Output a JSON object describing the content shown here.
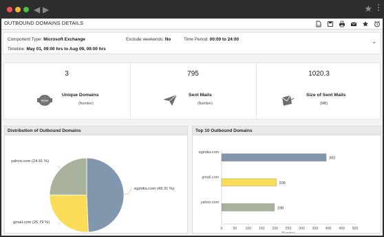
{
  "browser": {
    "back_icon": "chevron-left-icon",
    "forward_icon": "chevron-right-icon",
    "bookmark_icon": "star-icon",
    "menu_icon": "kebab-menu-icon"
  },
  "header": {
    "title": "OUTBOUND DOMAINS DETAILS",
    "icons": [
      "export-pdf-icon",
      "save-icon",
      "print-icon",
      "email-icon",
      "bookmark-star-icon",
      "schedule-clock-icon"
    ]
  },
  "filters": {
    "component_type_label": "Component Type:",
    "component_type_value": "Microsoft Exchange",
    "exclude_weekends_label": "Exclude weekends:",
    "exclude_weekends_value": "No",
    "time_period_label": "Time Period:",
    "time_period_value": "00:00 to 24:00",
    "timeline_label": "Timeline:",
    "timeline_value": "May 01, 09:00 hrs to Aug 09, 09:00 hrs"
  },
  "stats": [
    {
      "value": "3",
      "label": "Unique Domains",
      "unit": "(Number)",
      "icon": "www-globe-icon"
    },
    {
      "value": "795",
      "label": "Sent Mails",
      "unit": "(Number)",
      "icon": "paper-plane-icon"
    },
    {
      "value": "1020.3",
      "label": "Size of Sent Mails",
      "unit": "(MB)",
      "icon": "mail-size-icon"
    }
  ],
  "panels": {
    "pie_title": "Distribution of Outbound Domains",
    "bar_title": "Top 10 Outbound Domains"
  },
  "colors": {
    "egindia": "#8197ad",
    "gmail": "#fbdc56",
    "yahoo": "#a9b29a"
  },
  "chart_data": [
    {
      "type": "pie",
      "title": "Distribution of Outbound Domains",
      "slices": [
        {
          "name": "egindia.com",
          "value": 49.31,
          "label": "egindia.com (49.31 %)"
        },
        {
          "name": "gmail.com",
          "value": 25.79,
          "label": "gmail.com (25.79 %)"
        },
        {
          "name": "yahoo.com",
          "value": 24.91,
          "label": "yahoo.com (24.91 %)"
        }
      ]
    },
    {
      "type": "bar",
      "orientation": "horizontal",
      "title": "Top 10 Outbound Domains",
      "categories": [
        "egindia.com",
        "gmail.com",
        "yahoo.com"
      ],
      "values": [
        392,
        205,
        198
      ],
      "xlabel": "Number",
      "xlim": [
        0,
        500
      ],
      "xticks": [
        0,
        50,
        100,
        150,
        200,
        250,
        300,
        350,
        400,
        450,
        500
      ]
    }
  ]
}
